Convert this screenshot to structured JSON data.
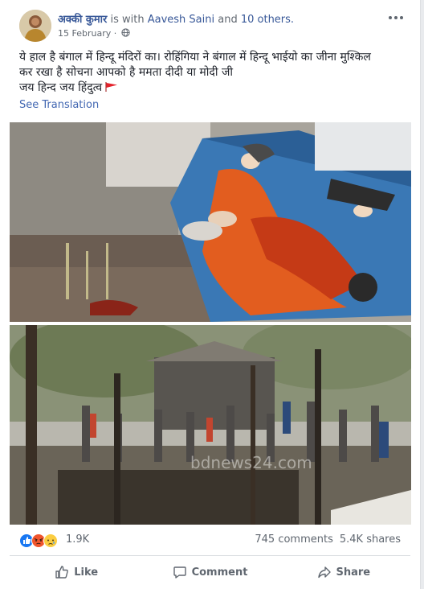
{
  "post": {
    "author": "अक्की कुमार",
    "with_text": " is with ",
    "tagged_person": "Aavesh Saini",
    "and_text": " and ",
    "others": "10 others.",
    "date": "15 February",
    "separator": " · ",
    "privacy_icon": "globe-icon",
    "more_icon": "more-options-icon",
    "text_lines": [
      "ये हाल है बंगाल में हिन्दू मंदिरों का। रोहिंगिया ने बंगाल में हिन्दू भाईयो का जीना मुश्किल",
      "कर रखा है सोचना आपको है ममता दीदी या मोदी जी",
      "जय हिन्द जय हिंदुत्व"
    ],
    "see_translation": "See Translation",
    "watermark": "bdnews24.com"
  },
  "stats": {
    "reaction_icons": [
      "like-reaction-icon",
      "angry-reaction-icon",
      "sad-reaction-icon"
    ],
    "reaction_count": "1.9K",
    "comments": "745 comments",
    "shares": "5.4K shares"
  },
  "actions": {
    "like": "Like",
    "comment": "Comment",
    "share": "Share"
  },
  "colors": {
    "link": "#385898",
    "secondary_text": "#606770",
    "translation": "#4267b2",
    "like_blue": "#1877f2",
    "angry": "#f0552d",
    "sad": "#fbcd41"
  }
}
